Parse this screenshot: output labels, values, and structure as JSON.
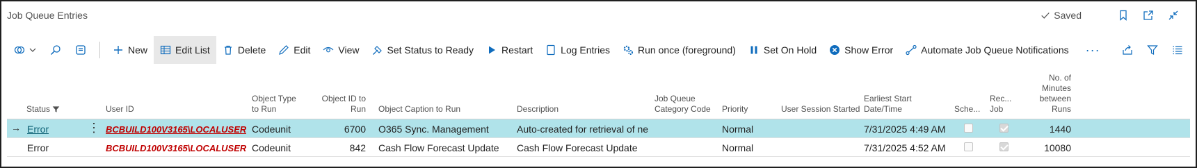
{
  "window": {
    "title": "Job Queue Entries",
    "saved_label": "Saved",
    "icons": [
      "bookmark-icon",
      "open-new-window-icon",
      "collapse-icon"
    ]
  },
  "toolbar": {
    "new": "New",
    "edit_list": "Edit List",
    "delete": "Delete",
    "edit": "Edit",
    "view": "View",
    "set_status_ready": "Set Status to Ready",
    "restart": "Restart",
    "log_entries": "Log Entries",
    "run_once": "Run once (foreground)",
    "set_on_hold": "Set On Hold",
    "show_error": "Show Error",
    "automate": "Automate Job Queue Notifications",
    "more": "···"
  },
  "columns": {
    "status": "Status",
    "user_id": "User ID",
    "object_type_1": "Object Type",
    "object_type_2": "to Run",
    "object_id_1": "Object ID to",
    "object_id_2": "Run",
    "object_caption": "Object Caption to Run",
    "description": "Description",
    "category_1": "Job Queue",
    "category_2": "Category Code",
    "priority": "Priority",
    "user_session": "User Session Started",
    "earliest_1": "Earliest Start",
    "earliest_2": "Date/Time",
    "scheduled": "Sche...",
    "recurring_1": "Rec...",
    "recurring_2": "Job",
    "minutes_1": "No. of",
    "minutes_2": "Minutes",
    "minutes_3": "between",
    "minutes_4": "Runs"
  },
  "rows": [
    {
      "status": "Error",
      "user_id": "BCBUILD100V3165\\LOCALUSER",
      "object_type": "Codeunit",
      "object_id": "6700",
      "object_caption": "O365 Sync. Management",
      "description": "Auto-created for retrieval of ne...",
      "category": "",
      "priority": "Normal",
      "user_session": "",
      "earliest": "7/31/2025 4:49 AM",
      "scheduled": false,
      "recurring": true,
      "minutes": "1440"
    },
    {
      "status": "Error",
      "user_id": "BCBUILD100V3165\\LOCALUSER",
      "object_type": "Codeunit",
      "object_id": "842",
      "object_caption": "Cash Flow Forecast Update",
      "description": "Cash Flow Forecast Update",
      "category": "",
      "priority": "Normal",
      "user_session": "",
      "earliest": "7/31/2025 4:52 AM",
      "scheduled": false,
      "recurring": true,
      "minutes": "10080"
    }
  ],
  "colors": {
    "selected_row": "#b0e3ea",
    "user_id_text": "#c00000",
    "link": "#0a5f73"
  }
}
